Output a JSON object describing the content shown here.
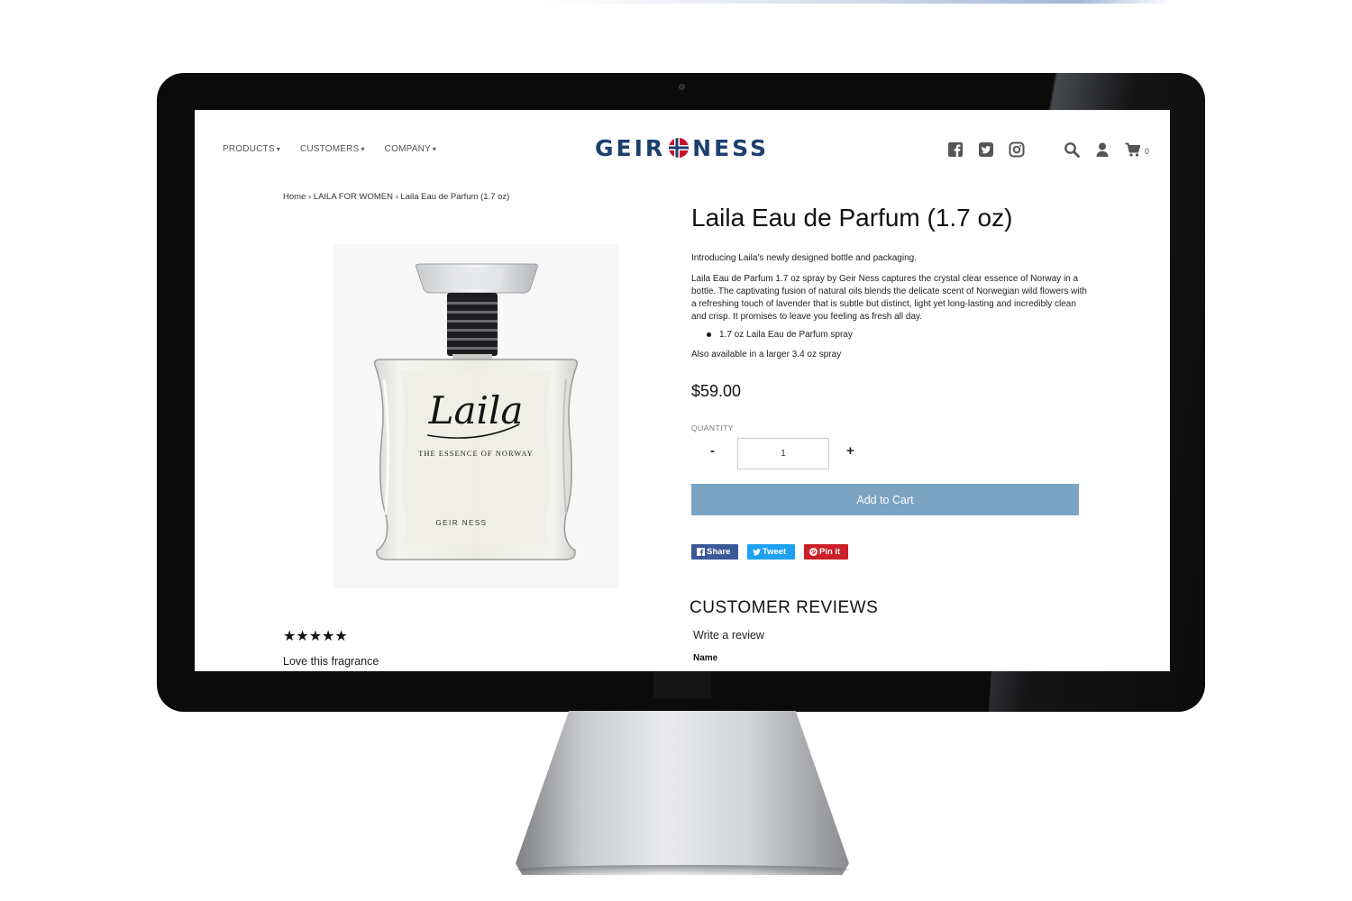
{
  "nav": {
    "items": [
      {
        "label": "PRODUCTS"
      },
      {
        "label": "CUSTOMERS"
      },
      {
        "label": "COMPANY"
      }
    ]
  },
  "logo": {
    "left": "GEIR",
    "right": "NESS"
  },
  "header": {
    "cart_count": "0"
  },
  "breadcrumb": {
    "home": "Home",
    "sep": " › ",
    "category": "LAILA FOR WOMEN",
    "current": "Laila Eau de Parfum (1.7 oz)"
  },
  "product": {
    "title": "Laila Eau de Parfum (1.7 oz)",
    "intro": "Introducing Laila’s newly designed bottle and packaging.",
    "description": "Laila Eau de Parfum 1.7 oz spray by Geir Ness captures the crystal clear essence of Norway in a bottle. The captivating fusion of natural oils blends the delicate scent of Norwegian wild flowers with a refreshing touch of lavender that is subtle but distinct, light yet long-lasting and incredibly clean and crisp. It promises to leave you feeling as fresh all day.",
    "bullet": "1.7 oz Laila Eau de Parfum spray",
    "also": "Also available in a larger 3.4 oz  spray",
    "price": "$59.00",
    "bottle_script": "Laila",
    "bottle_tagline": "THE ESSENCE OF NORWAY",
    "bottle_brand": "GEIR NESS"
  },
  "quantity": {
    "label": "QUANTITY",
    "minus": "-",
    "plus": "+",
    "value": "1"
  },
  "cart": {
    "add_label": "Add to Cart"
  },
  "share": {
    "facebook": "Share",
    "twitter": "Tweet",
    "pinterest": "Pin it"
  },
  "review": {
    "stars": "★★★★★",
    "rating": 5,
    "title": "Love this fragrance"
  },
  "reviews": {
    "heading": "CUSTOMER REVIEWS",
    "write": "Write a review",
    "name_label": "Name"
  },
  "colors": {
    "brand": "#1c3f6e",
    "add_to_cart": "#7aa3c4",
    "facebook": "#3b5998",
    "twitter": "#1ea1f2",
    "pinterest": "#cb2027"
  },
  "icons": [
    "facebook-icon",
    "twitter-icon",
    "instagram-icon",
    "search-icon",
    "user-icon",
    "cart-icon"
  ]
}
